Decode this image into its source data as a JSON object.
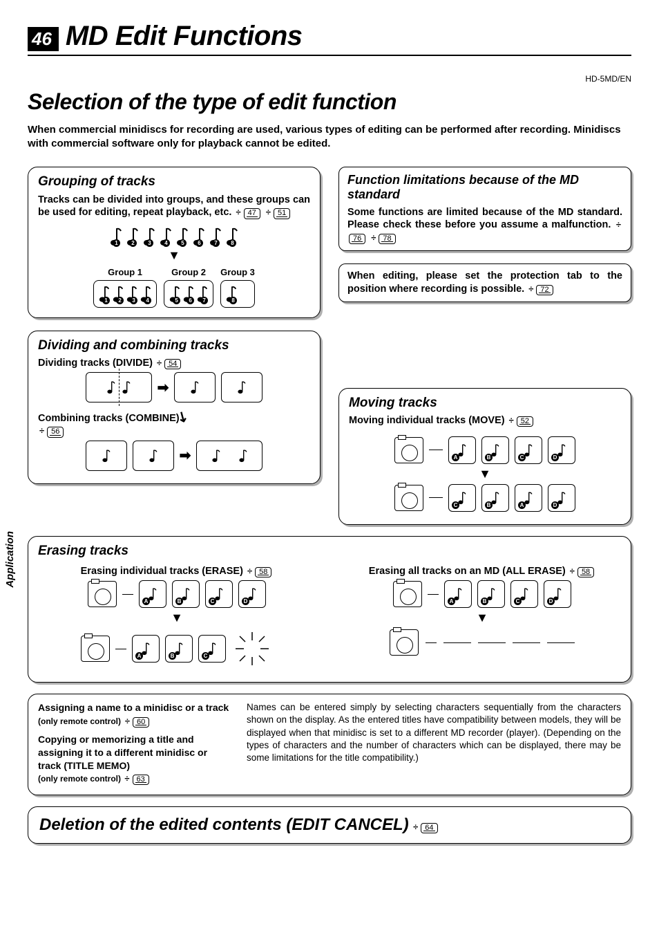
{
  "page_number": "46",
  "chapter_title": "MD Edit Functions",
  "model": "HD-5MD/EN",
  "section_title": "Selection of the type of edit function",
  "intro": "When commercial minidiscs for recording are used, various types of editing can be performed after recording. Minidiscs with commercial software only for playback cannot be edited.",
  "side_tab": "Application",
  "grouping": {
    "title": "Grouping of tracks",
    "text": "Tracks can be divided into groups, and these groups can be used for editing, repeat playback, etc.",
    "refs": [
      "47",
      "51"
    ],
    "group_labels": [
      "Group 1",
      "Group 2",
      "Group 3"
    ]
  },
  "limitations": {
    "title": "Function limitations because of the MD standard",
    "text": "Some functions are limited because of the MD standard. Please check these before you assume a malfunction.",
    "refs": [
      "76",
      "78"
    ]
  },
  "protect": {
    "text": "When editing, please set the protection tab to the position where recording is possible.",
    "ref": "72"
  },
  "divcomb": {
    "title": "Dividing and combining tracks",
    "divide_label": "Dividing tracks (DIVIDE)",
    "divide_ref": "54",
    "combine_label": "Combining tracks (COMBINE)",
    "combine_ref": "56"
  },
  "moving": {
    "title": "Moving tracks",
    "label": "Moving individual tracks (MOVE)",
    "ref": "52",
    "before": [
      "A",
      "B",
      "C",
      "D"
    ],
    "after": [
      "C",
      "B",
      "A",
      "D"
    ]
  },
  "erasing": {
    "title": "Erasing tracks",
    "indiv_label": "Erasing individual tracks (ERASE)",
    "indiv_ref": "58",
    "all_label": "Erasing all tracks on an MD (ALL ERASE)",
    "all_ref": "58",
    "tracks": [
      "A",
      "B",
      "C",
      "D"
    ],
    "remaining": [
      "A",
      "B",
      "C"
    ]
  },
  "naming": {
    "assign_label": "Assigning a name to a minidisc or a track",
    "assign_note": "(only remote control)",
    "assign_ref": "60",
    "copy_label": "Copying or memorizing a title and assigning it to a different minidisc or track (TITLE MEMO)",
    "copy_note": "(only remote control)",
    "copy_ref": "63",
    "explain": "Names can be entered simply by selecting characters sequentially from the characters shown on the display. As the entered titles have compatibility between models, they will be displayed when that minidisc is set to a different MD recorder (player). (Depending on the types of characters and the number of characters which can be displayed, there may be some limitations for the title compatibility.)"
  },
  "deletion": {
    "title": "Deletion of the edited contents (EDIT CANCEL)",
    "ref": "64"
  }
}
